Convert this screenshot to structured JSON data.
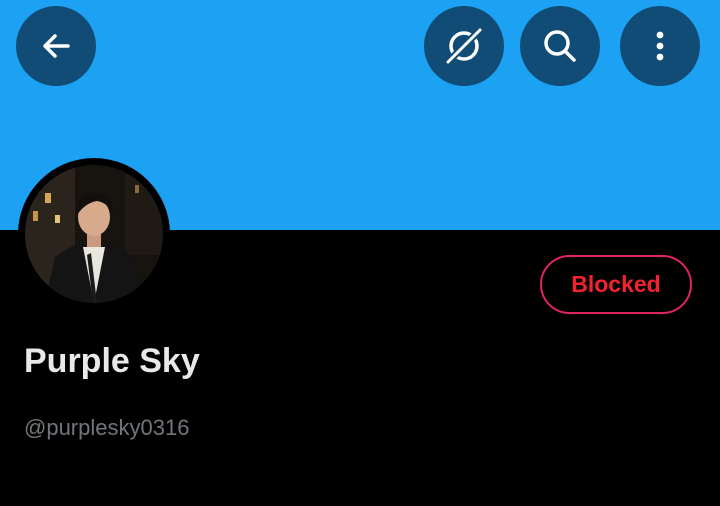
{
  "colors": {
    "banner": "#1DA1F2",
    "icon_button_bg": "#104C75",
    "blocked": "#F4212E",
    "name_text": "#E7E9EA",
    "handle_text": "#71767B"
  },
  "header": {
    "icons": [
      "back-arrow-icon",
      "grok-icon",
      "search-icon",
      "more-vertical-icon"
    ]
  },
  "profile": {
    "display_name": "Purple Sky",
    "handle": "@purplesky0316",
    "blocked_label": "Blocked"
  }
}
